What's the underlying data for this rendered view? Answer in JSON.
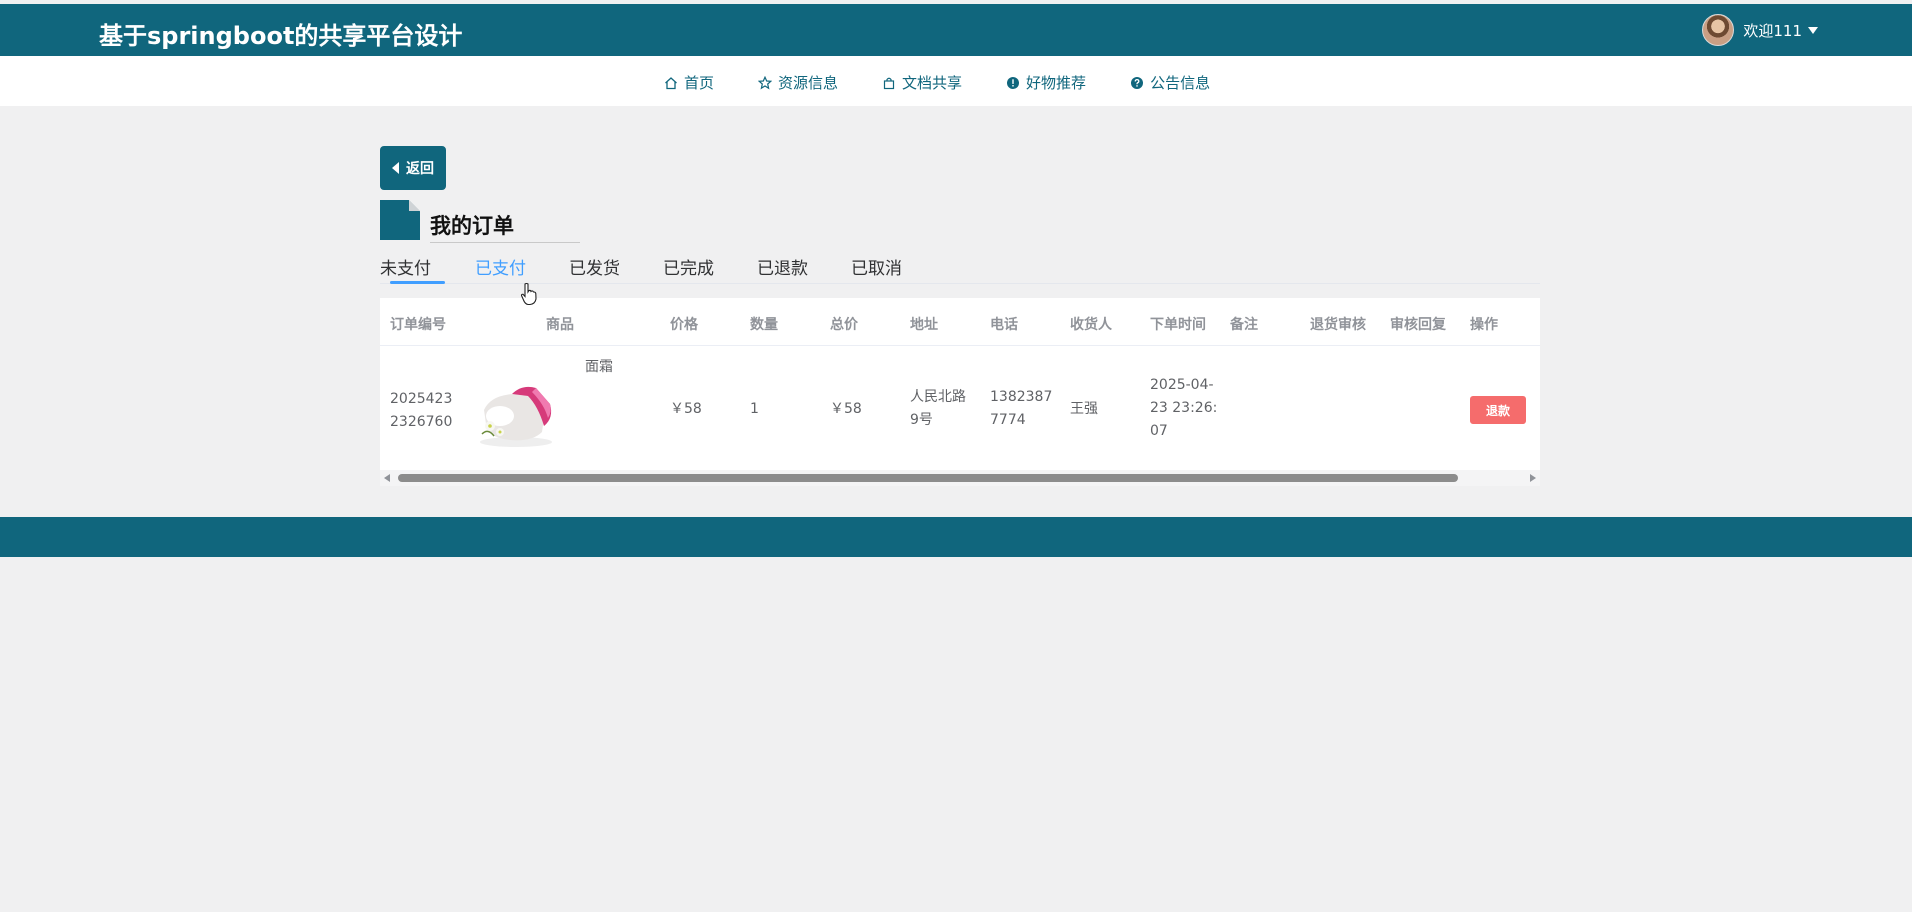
{
  "header": {
    "site_title": "基于springboot的共享平台设计",
    "welcome": "欢迎111"
  },
  "nav": {
    "items": [
      {
        "label": "首页",
        "icon": "home-icon"
      },
      {
        "label": "资源信息",
        "icon": "star-icon"
      },
      {
        "label": "文档共享",
        "icon": "bag-icon"
      },
      {
        "label": "好物推荐",
        "icon": "exclamation-circle-icon"
      },
      {
        "label": "公告信息",
        "icon": "question-circle-icon"
      }
    ]
  },
  "page": {
    "back_label": "返回",
    "title": "我的订单"
  },
  "tabs": [
    {
      "label": "未支付"
    },
    {
      "label": "已支付",
      "active": true
    },
    {
      "label": "已发货"
    },
    {
      "label": "已完成"
    },
    {
      "label": "已退款"
    },
    {
      "label": "已取消"
    }
  ],
  "table": {
    "columns": [
      "订单编号",
      "商品",
      "价格",
      "数量",
      "总价",
      "地址",
      "电话",
      "收货人",
      "下单时间",
      "备注",
      "退货审核",
      "审核回复",
      "操作"
    ],
    "rows": [
      {
        "order_no_l1": "2025423",
        "order_no_l2": "2326760",
        "product_name": "面霜",
        "price": "￥58",
        "quantity": "1",
        "total": "￥58",
        "address_l1": "人民北路",
        "address_l2": "9号",
        "phone_l1": "1382387",
        "phone_l2": "7774",
        "receiver": "王强",
        "time_l1": "2025-04-",
        "time_l2": "23 23:26:",
        "time_l3": "07",
        "action_label": "退款"
      }
    ]
  },
  "colors": {
    "primary": "#10667d",
    "active_tab": "#409eff",
    "danger": "#f56c6c",
    "background": "#f0f0f1"
  }
}
